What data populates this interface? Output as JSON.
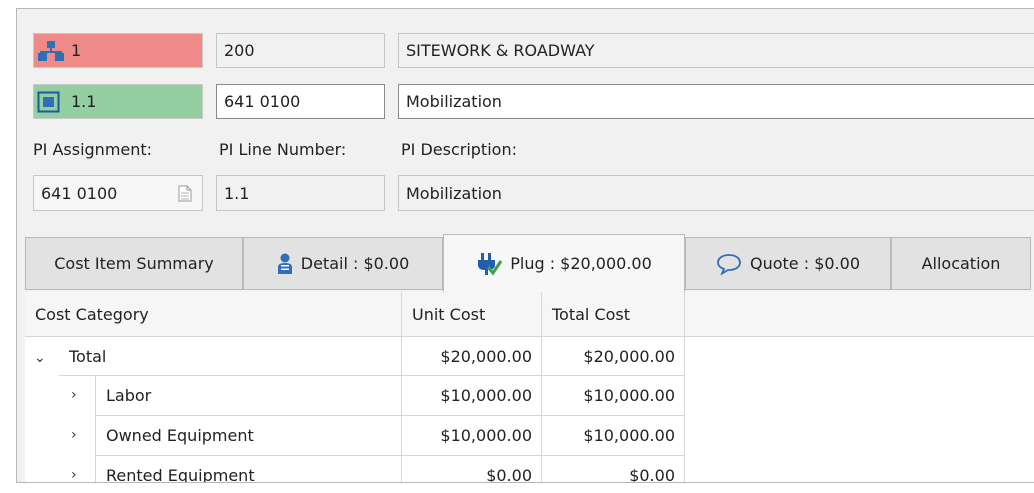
{
  "header": {
    "level1": {
      "code": "1",
      "number": "200",
      "description": "SITEWORK & ROADWAY"
    },
    "level2": {
      "code": "1.1",
      "number": "641 0100",
      "description": "Mobilization"
    }
  },
  "pi": {
    "assignment_label": "PI Assignment:",
    "line_number_label": "PI Line Number:",
    "description_label": "PI Description:",
    "assignment_value": "641 0100",
    "line_number_value": "1.1",
    "description_value": "Mobilization"
  },
  "tabs": [
    {
      "label": "Cost Item Summary",
      "icon": "none"
    },
    {
      "label": "Detail : $0.00",
      "icon": "person-icon"
    },
    {
      "label": "Plug : $20,000.00",
      "icon": "plug-icon",
      "active": true
    },
    {
      "label": "Quote : $0.00",
      "icon": "speech-bubble-icon"
    },
    {
      "label": "Allocation",
      "icon": "none"
    }
  ],
  "grid": {
    "columns": [
      "Cost Category",
      "Unit Cost",
      "Total Cost"
    ],
    "rows": [
      {
        "name": "Total",
        "unit_cost": "$20,000.00",
        "total_cost": "$20,000.00",
        "expander": "down"
      },
      {
        "name": "Labor",
        "unit_cost": "$10,000.00",
        "total_cost": "$10,000.00",
        "expander": "right"
      },
      {
        "name": "Owned Equipment",
        "unit_cost": "$10,000.00",
        "total_cost": "$10,000.00",
        "expander": "right"
      },
      {
        "name": "Rented Equipment",
        "unit_cost": "$0.00",
        "total_cost": "$0.00",
        "expander": "right"
      }
    ]
  },
  "colors": {
    "level1": "#ee8b89",
    "level2": "#93cfa0",
    "icon_blue": "#2f6fb7",
    "plug_blue": "#1f5fae",
    "plug_green": "#3aa24a"
  }
}
